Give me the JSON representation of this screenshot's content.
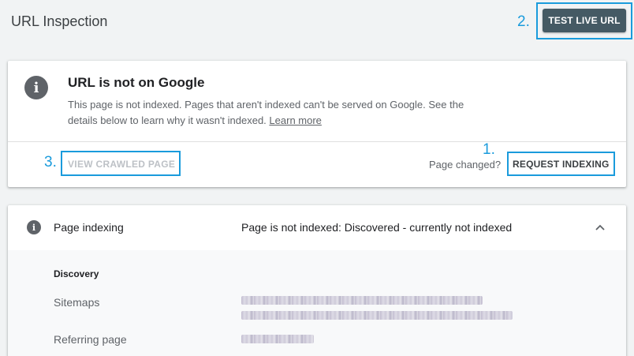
{
  "header": {
    "title": "URL Inspection",
    "test_live_label": "TEST LIVE URL"
  },
  "annotations": {
    "one": "1.",
    "two": "2.",
    "three": "3.",
    "color": "#1a9bdc"
  },
  "status_card": {
    "icon": "info-icon",
    "title": "URL is not on Google",
    "description": "This page is not indexed. Pages that aren't indexed can't be served on Google. See the details below to learn why it wasn't indexed.",
    "learn_more": "Learn more",
    "view_crawled_label": "VIEW CRAWLED PAGE",
    "page_changed_label": "Page changed?",
    "request_indexing_label": "REQUEST INDEXING"
  },
  "indexing_card": {
    "icon": "info-icon",
    "label": "Page indexing",
    "status": "Page is not indexed: Discovered - currently not indexed",
    "expanded": true,
    "discovery_heading": "Discovery",
    "rows": [
      {
        "label": "Sitemaps"
      },
      {
        "label": "Referring page"
      }
    ]
  },
  "colors": {
    "button_dark": "#455a64",
    "background": "#f1f3f4",
    "icon_gray": "#5f6368"
  }
}
